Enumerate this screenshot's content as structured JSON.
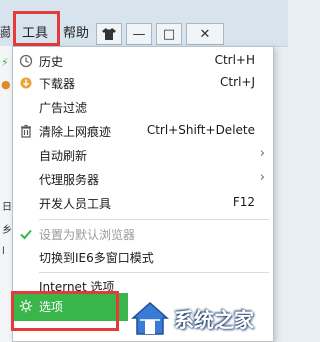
{
  "toolbar": {
    "left_clip": "藏",
    "tools_label": "工具",
    "help_label": "帮助",
    "shirt_icon": "shirt-icon",
    "minimize_glyph": "—",
    "maximize_glyph": "□",
    "close_glyph": "✕"
  },
  "gutter": {
    "texts": [
      "日",
      "乡",
      "l"
    ]
  },
  "menu": {
    "items": [
      {
        "label": "历史",
        "shortcut": "Ctrl+H",
        "icon": "clock-icon"
      },
      {
        "label": "下载器",
        "shortcut": "Ctrl+J",
        "icon": "download-icon"
      },
      {
        "label": "广告过滤",
        "shortcut": "",
        "icon": ""
      },
      {
        "label": "清除上网痕迹",
        "shortcut": "Ctrl+Shift+Delete",
        "icon": "trash-icon"
      },
      {
        "label": "自动刷新",
        "shortcut": "",
        "icon": ""
      },
      {
        "label": "代理服务器",
        "shortcut": "",
        "icon": ""
      },
      {
        "label": "开发人员工具",
        "shortcut": "F12",
        "icon": ""
      },
      {
        "label": "设置为默认浏览器",
        "shortcut": "",
        "icon": "check-icon"
      },
      {
        "label": "切换到IE6多窗口模式",
        "shortcut": "",
        "icon": ""
      },
      {
        "label": "Internet 选项",
        "shortcut": "",
        "icon": ""
      },
      {
        "label": "选项",
        "shortcut": "",
        "icon": "gear-icon"
      }
    ]
  },
  "watermark": {
    "text": "系统之家"
  },
  "colors": {
    "highlight_green": "#39b54a",
    "annotation_red": "#e33b3b",
    "check_green": "#39b54a"
  }
}
